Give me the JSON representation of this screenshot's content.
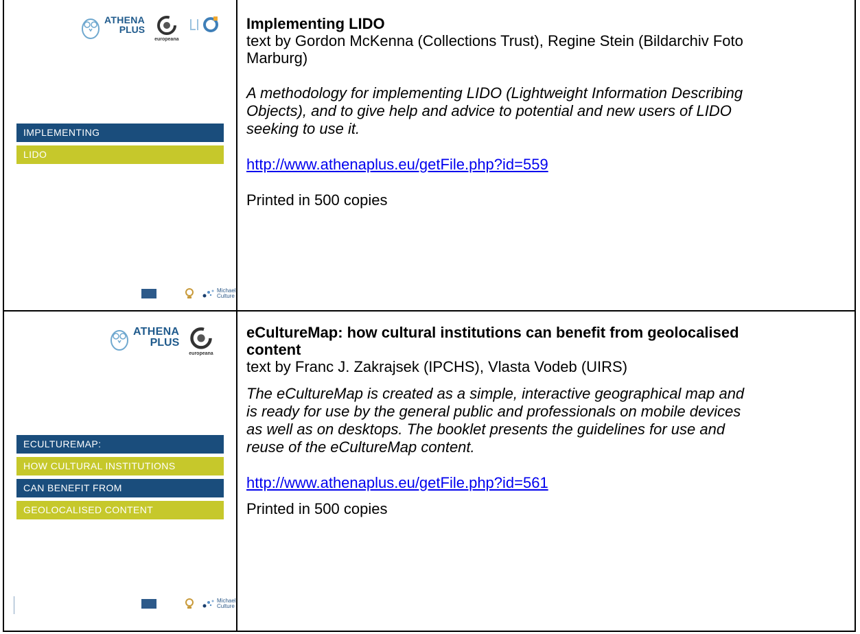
{
  "entries": [
    {
      "title": "Implementing LIDO",
      "authors_line1": "text by Gordon McKenna (Collections Trust), Regine Stein (Bildarchiv Foto",
      "authors_line2": "Marburg)",
      "desc_lines": [
        "A methodology for implementing LIDO (Lightweight Information Describing",
        "Objects), and to give help and advice to potential and new users of LIDO",
        "seeking to use it."
      ],
      "link": "http://www.athenaplus.eu/getFile.php?id=559",
      "printed": "Printed in 500 copies",
      "cover": {
        "bands": [
          "IMPLEMENTING",
          "LIDO"
        ]
      }
    },
    {
      "title_lines": [
        "eCultureMap: how cultural institutions can benefit from geolocalised",
        "content"
      ],
      "authors": "text by Franc J. Zakrajsek (IPCHS), Vlasta Vodeb (UIRS)",
      "desc_lines": [
        "The eCultureMap is created as a simple, interactive geographical map and",
        "is ready for use by the general public and professionals on mobile devices",
        "as well as on desktops. The booklet presents the guidelines for use and",
        "reuse of the eCultureMap content."
      ],
      "link": "http://www.athenaplus.eu/getFile.php?id=561",
      "printed": "Printed in 500 copies",
      "cover": {
        "bands": [
          "ECULTUREMAP:",
          "HOW CULTURAL INSTITUTIONS",
          "CAN BENEFIT FROM",
          "GEOLOCALISED CONTENT"
        ]
      }
    }
  ],
  "logos": {
    "athena_name": "ATHENA",
    "athena_plus": "PLUS",
    "europeana": "europeana",
    "michael_line1": "Michael",
    "michael_line2": "Culture"
  },
  "colors": {
    "navy_band": "#1a4d7c",
    "lime_band": "#c6c82b",
    "link": "#0000ee"
  }
}
